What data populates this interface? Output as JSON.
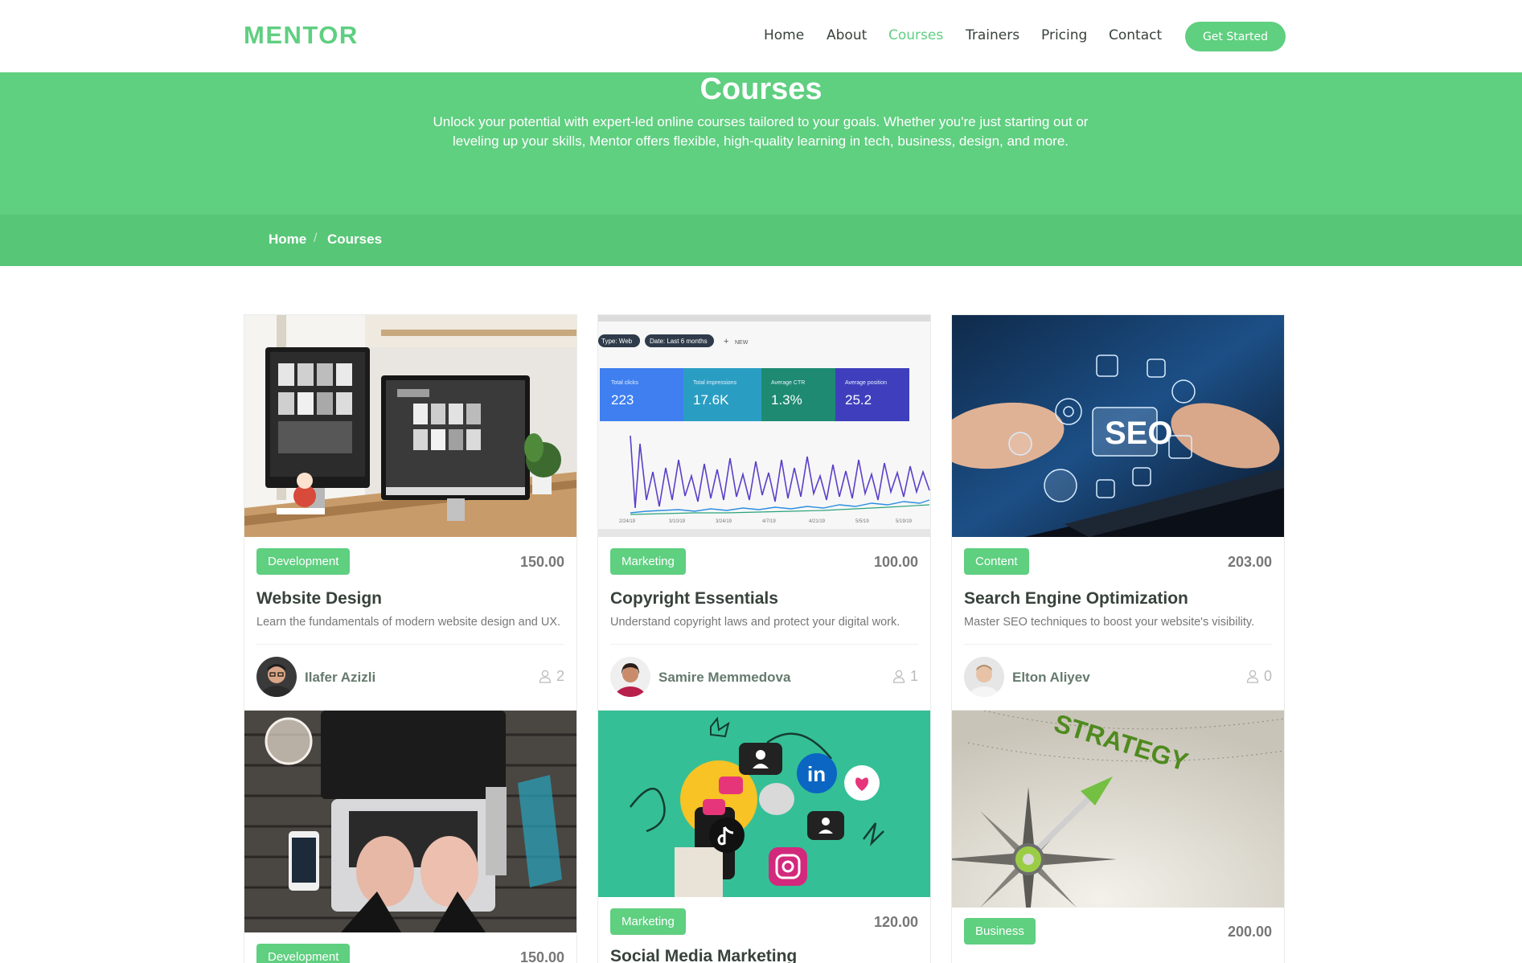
{
  "brand": {
    "logo": "MENTOR",
    "colors": {
      "accent": "#5fcf80",
      "accent_dark": "#58c677",
      "text": "#37423b",
      "muted": "#777777"
    }
  },
  "nav": {
    "items": [
      {
        "label": "Home",
        "active": false
      },
      {
        "label": "About",
        "active": false
      },
      {
        "label": "Courses",
        "active": true
      },
      {
        "label": "Trainers",
        "active": false
      },
      {
        "label": "Pricing",
        "active": false
      },
      {
        "label": "Contact",
        "active": false
      }
    ],
    "cta_label": "Get Started"
  },
  "hero": {
    "title": "Courses",
    "subtitle": "Unlock your potential with expert-led online courses tailored to your goals. Whether you're just starting out or leveling up your skills, Mentor offers flexible, high-quality learning in tech, business, design, and more."
  },
  "breadcrumb": {
    "items": [
      "Home",
      "Courses"
    ],
    "separator": "/"
  },
  "courses": [
    {
      "image": "desk-with-monitors-photo",
      "category": "Development",
      "price": "150.00",
      "title": "Website Design",
      "description": "Learn the fundamentals of modern website design and UX.",
      "trainer": "Ilafer Azizli",
      "likes": "2"
    },
    {
      "image": "analytics-dashboard-photo",
      "category": "Marketing",
      "price": "100.00",
      "title": "Copyright Essentials",
      "description": "Understand copyright laws and protect your digital work.",
      "trainer": "Samire Memmedova",
      "likes": "1",
      "image_text": {
        "filter1": "Type: Web",
        "filter2": "Date: Last 6 months",
        "new": "NEW",
        "metrics": [
          {
            "label": "Total clicks",
            "value": "223"
          },
          {
            "label": "Total impressions",
            "value": "17.6K"
          },
          {
            "label": "Average CTR",
            "value": "1.3%"
          },
          {
            "label": "Average position",
            "value": "25.2"
          }
        ],
        "dates": [
          "2/24/19",
          "3/10/19",
          "3/24/19",
          "4/7/19",
          "4/21/19",
          "5/5/19",
          "5/19/19"
        ]
      }
    },
    {
      "image": "seo-hologram-photo",
      "category": "Content",
      "price": "203.00",
      "title": "Search Engine Optimization",
      "description": "Master SEO techniques to boost your website's visibility.",
      "trainer": "Elton Aliyev",
      "likes": "0",
      "image_text": {
        "seo": "SEO"
      }
    },
    {
      "image": "laptop-on-wooden-table-photo",
      "category": "Development",
      "price": "150.00"
    },
    {
      "image": "social-media-illustration",
      "category": "Marketing",
      "price": "120.00",
      "title": "Social Media Marketing"
    },
    {
      "image": "strategy-compass-photo",
      "category": "Business",
      "price": "200.00",
      "image_text": {
        "word": "STRATEGY"
      }
    }
  ]
}
